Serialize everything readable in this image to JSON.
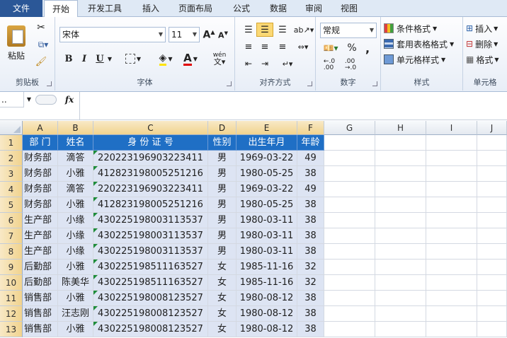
{
  "ribbon_tabs": [
    "文件",
    "开始",
    "开发工具",
    "插入",
    "页面布局",
    "公式",
    "数据",
    "审阅",
    "视图"
  ],
  "clipboard": {
    "paste": "粘贴",
    "label": "剪贴板"
  },
  "font": {
    "name": "宋体",
    "size": "11",
    "label": "字体",
    "bold": "B",
    "italic": "I",
    "underline": "U",
    "special": "wén"
  },
  "alignment": {
    "label": "对齐方式"
  },
  "number": {
    "format": "常规",
    "label": "数字",
    "percent": "%",
    "comma": ","
  },
  "styles": {
    "cond": "条件格式",
    "table": "套用表格格式",
    "cell": "单元格样式",
    "label": "样式"
  },
  "cells": {
    "insert": "插入",
    "delete": "删除",
    "format": "格式",
    "label": "单元格"
  },
  "formula_bar": {
    "name_box": "..",
    "fx": "fx",
    "value": ""
  },
  "column_headers": [
    "A",
    "B",
    "C",
    "D",
    "E",
    "F",
    "G",
    "H",
    "I",
    "J"
  ],
  "row_numbers": [
    "1",
    "2",
    "3",
    "4",
    "5",
    "6",
    "7",
    "8",
    "9",
    "10",
    "11",
    "12",
    "13"
  ],
  "table": {
    "headers": [
      "部 门",
      "姓名",
      "身 份 证 号",
      "性别",
      "出生年月",
      "年龄"
    ],
    "rows": [
      [
        "财务部",
        "滴答",
        "220223196903223411",
        "男",
        "1969-03-22",
        "49"
      ],
      [
        "财务部",
        "小雅",
        "412823198005251216",
        "男",
        "1980-05-25",
        "38"
      ],
      [
        "财务部",
        "滴答",
        "220223196903223411",
        "男",
        "1969-03-22",
        "49"
      ],
      [
        "财务部",
        "小雅",
        "412823198005251216",
        "男",
        "1980-05-25",
        "38"
      ],
      [
        "生产部",
        "小缘",
        "430225198003113537",
        "男",
        "1980-03-11",
        "38"
      ],
      [
        "生产部",
        "小缘",
        "430225198003113537",
        "男",
        "1980-03-11",
        "38"
      ],
      [
        "生产部",
        "小缘",
        "430225198003113537",
        "男",
        "1980-03-11",
        "38"
      ],
      [
        "后勤部",
        "小雅",
        "430225198511163527",
        "女",
        "1985-11-16",
        "32"
      ],
      [
        "后勤部",
        "陈美华",
        "430225198511163527",
        "女",
        "1985-11-16",
        "32"
      ],
      [
        "销售部",
        "小雅",
        "430225198008123527",
        "女",
        "1980-08-12",
        "38"
      ],
      [
        "销售部",
        "汪志刚",
        "430225198008123527",
        "女",
        "1980-08-12",
        "38"
      ],
      [
        "销售部",
        "小雅",
        "430225198008123527",
        "女",
        "1980-08-12",
        "38"
      ]
    ]
  },
  "colors": {
    "header_bg": "#1f6fc5",
    "selection": "#dde4f3",
    "file_tab": "#2b5797"
  }
}
